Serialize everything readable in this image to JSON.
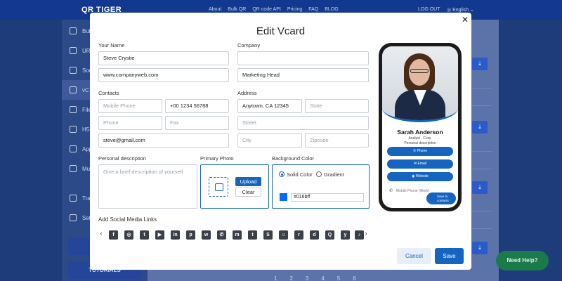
{
  "app": {
    "logo": "QR TIGER",
    "nav": [
      "About",
      "Bulk QR",
      "QR code API",
      "Pricing",
      "FAQ",
      "BLOG"
    ],
    "logout": "LOG OUT",
    "language": "English",
    "sidebar": [
      {
        "label": "Bul",
        "icon": "bulk-icon"
      },
      {
        "label": "UR",
        "icon": "link-icon"
      },
      {
        "label": "Soc",
        "icon": "chat-icon"
      },
      {
        "label": "vC",
        "icon": "person-icon"
      },
      {
        "label": "File",
        "icon": "file-icon"
      },
      {
        "label": "H5",
        "icon": "h5-icon"
      },
      {
        "label": "App",
        "icon": "app-icon"
      },
      {
        "label": "Mu",
        "icon": "share-icon"
      },
      {
        "label": "Tra",
        "icon": "trash-icon"
      },
      {
        "label": "Set",
        "icon": "gear-icon"
      }
    ],
    "sidebar_button": "TUTORIALS",
    "pager": [
      "1",
      "2",
      "3",
      "4",
      "5",
      "6"
    ],
    "need_help": "Need Help?"
  },
  "modal": {
    "title": "Edit Vcard",
    "your_name_label": "Your Name",
    "name_value": "Steve Crystie",
    "website_value": "www.companyweb.com",
    "company_label": "Company",
    "company_value": "",
    "title_value": "Marketing Head",
    "contacts_label": "Contacts",
    "mobile_placeholder": "Mobile Phone",
    "mobile_value2": "+00 1234 56788",
    "phone_placeholder": "Phone",
    "fax_placeholder": "Fax",
    "email_value": "steve@gmail.com",
    "address_label": "Address",
    "city_value": "Anytown, CA 12345",
    "state_placeholder": "State",
    "street_placeholder": "Street",
    "city_placeholder": "City",
    "zipcode_placeholder": "Zipcode",
    "personal_desc_label": "Personal description",
    "personal_desc_placeholder": "Give a brief description of yourself",
    "primary_photo_label": "Primary Photo",
    "upload_label": "Upload",
    "clear_label": "Clear",
    "bg_color_label": "Background Color",
    "solid_color_label": "Solid Color",
    "gradient_label": "Gradient",
    "color_hex": "#016bff",
    "social_label": "Add Social Media Links",
    "social_icons": [
      "facebook-icon",
      "instagram-icon",
      "twitter-icon",
      "youtube-icon",
      "linkedin-icon",
      "pinterest-icon",
      "wechat-icon",
      "whatsapp-icon",
      "messenger-icon",
      "tumblr-icon",
      "skype-icon",
      "snapchat-icon",
      "reddit-icon",
      "discord-icon",
      "quora-icon",
      "yelp-icon",
      "tiktok-icon"
    ],
    "cancel_label": "Cancel",
    "save_label": "Save",
    "accent_color": "#1565c0"
  },
  "preview": {
    "name": "Sarah Anderson",
    "subtitle": "Analyst - Corp.",
    "subtitle2": "Personal description",
    "buttons": [
      "Phone",
      "Email",
      "Website"
    ],
    "mobile_label": "Mobile Phone (Work)",
    "save_contact": "Save to contacts"
  }
}
